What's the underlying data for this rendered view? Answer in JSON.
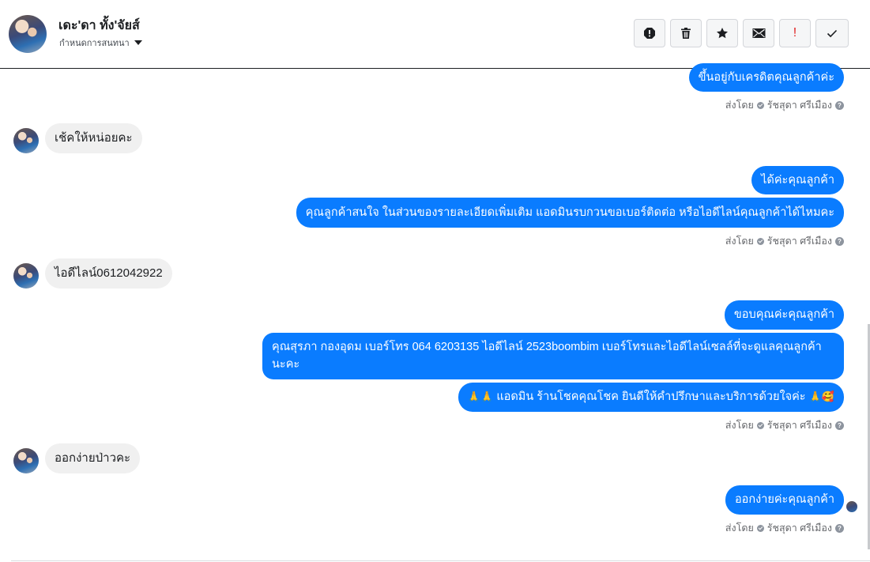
{
  "header": {
    "title": "เดะ'ดา ทั้ง'จัยส์",
    "subtitle": "กำหนดการสนทนา",
    "actions": [
      {
        "name": "report-icon"
      },
      {
        "name": "trash-icon"
      },
      {
        "name": "star-icon"
      },
      {
        "name": "envelope-icon"
      },
      {
        "name": "exclamation-icon",
        "glyph": "!"
      },
      {
        "name": "check-icon"
      }
    ]
  },
  "messages": {
    "m1": "ขึ้นอยู่กับเครดิตคุณลูกค้าค่ะ",
    "m2": "เช้คให้หน่อยคะ",
    "m3": "ได้ค่ะคุณลูกค้า",
    "m4": "คุณลูกค้าสนใจ ในส่วนของรายละเอียดเพิ่มเติม แอดมินรบกวนขอเบอร์ติดต่อ หรือไอดีไลน์คุณลูกค้าได้ไหมคะ",
    "m5": "ไอดีไลน์0612042922",
    "m6": "ขอบคุณค่ะคุณลูกค้า",
    "m7": "คุณสุรภา กองอุดม  เบอร์โทร 064 6203135 ไอดีไลน์ 2523boombim   เบอร์โทรและไอดีไลน์เซลล์ที่จะดูแลคุณลูกค้านะคะ",
    "m8_prefix": "🙏🙏",
    "m8": "แอดมิน ร้านโชคคุณโชค ยินดีให้คำปรึกษาและบริการด้วยใจค่ะ",
    "m8_suffix": "🙏🥰",
    "m9": "ออกง่ายป่าวคะ",
    "m10": "ออกง่ายค่ะคุณลูกค้า"
  },
  "sent_by": {
    "prefix": "ส่งโดย",
    "name": "รัชสุดา ศรีเมือง",
    "help": "?"
  },
  "colors": {
    "outgoing_bubble": "#0a7cff",
    "incoming_bubble": "#f0f0f0",
    "meta_text": "#65676b"
  }
}
